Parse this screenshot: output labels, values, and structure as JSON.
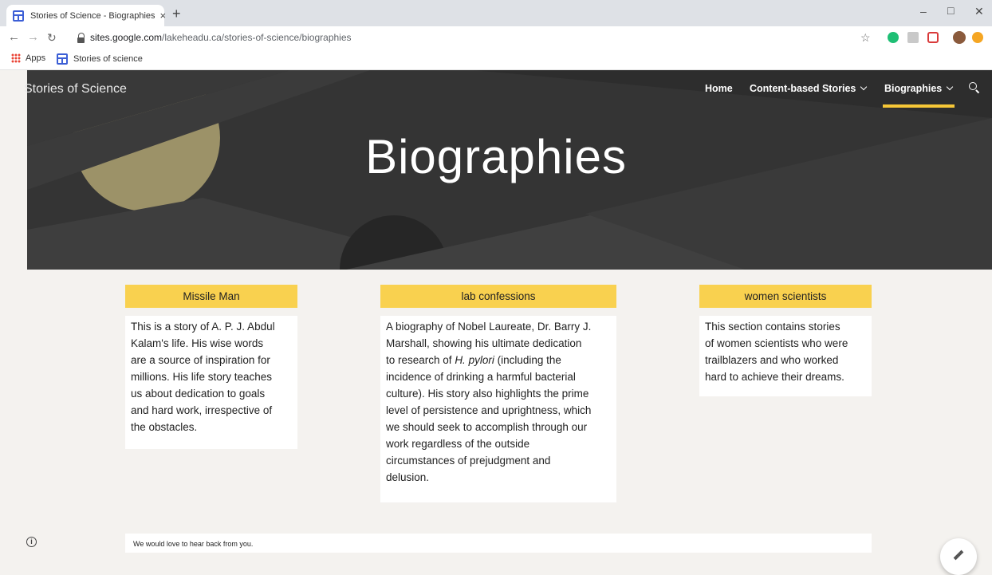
{
  "browser": {
    "tab_title": "Stories of Science - Biographies",
    "tab_close": "×",
    "new_tab": "+",
    "url_host": "sites.google.com",
    "url_path": "/lakeheadu.ca/stories-of-science/biographies",
    "bookmarks": [
      {
        "label": "Apps"
      },
      {
        "label": "Stories of science"
      }
    ]
  },
  "site": {
    "title": "Stories of Science",
    "nav": {
      "home": "Home",
      "content_stories": "Content-based Stories",
      "biographies": "Biographies"
    },
    "accent_color": "#f6c737",
    "hero_title": "Biographies"
  },
  "cards": [
    {
      "title": "Missile Man",
      "lines": [
        "This is a story of A. P. J. Abdul",
        "Kalam's life. His wise words",
        "are a source of inspiration for",
        "millions. His life story teaches",
        "us about dedication to goals",
        "and hard work, irrespective of",
        "the obstacles."
      ]
    },
    {
      "title": "lab confessions",
      "lines": [
        "A biography of Nobel Laureate, Dr. Barry J.",
        "Marshall, showing his ultimate dedication",
        "to research of",
        "H. pylori",
        " (including the",
        "incidence of drinking a harmful bacterial",
        "culture). His story also highlights the prime",
        "level of persistence and uprightness, which",
        "we should seek to accomplish through our",
        "work regardless of the outside",
        "circumstances of prejudgment and",
        "delusion."
      ]
    },
    {
      "title": "women scientists",
      "lines": [
        "This section contains stories",
        "of women scientists who were",
        "trailblazers and who worked",
        "hard to achieve their dreams."
      ]
    }
  ],
  "footer": {
    "text": "We would love to hear back from you."
  }
}
